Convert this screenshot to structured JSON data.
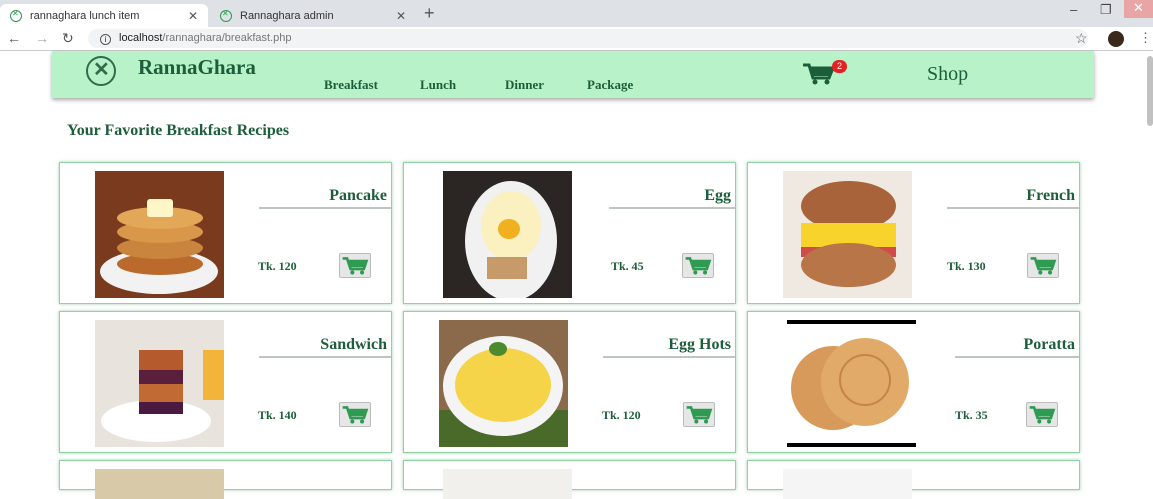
{
  "browser": {
    "tabs": [
      {
        "title": "rannaghara lunch item",
        "active": true
      },
      {
        "title": "Rannaghara admin",
        "active": false
      }
    ],
    "url_host": "localhost",
    "url_path": "/rannaghara/breakfast.php"
  },
  "header": {
    "brand": "RannaGhara",
    "nav": [
      "Breakfast",
      "Lunch",
      "Dinner",
      "Package"
    ],
    "cart_count": "2",
    "shop_label": "Shop"
  },
  "section_title": "Your Favorite Breakfast Recipes",
  "colors": {
    "accent": "#1d5e3a",
    "header_bg": "#b8f2c8",
    "cart_green": "#2f9a52"
  },
  "items": [
    {
      "name": "Pancake",
      "price": "Tk. 120",
      "icon": "pancake-image"
    },
    {
      "name": "Egg",
      "price": "Tk. 45",
      "icon": "egg-image"
    },
    {
      "name": "French",
      "price": "Tk. 130",
      "icon": "french-image"
    },
    {
      "name": "Sandwich",
      "price": "Tk. 140",
      "icon": "sandwich-image"
    },
    {
      "name": "Egg Hots",
      "price": "Tk. 120",
      "icon": "egg-hots-image"
    },
    {
      "name": "Poratta",
      "price": "Tk. 35",
      "icon": "poratta-image"
    }
  ]
}
